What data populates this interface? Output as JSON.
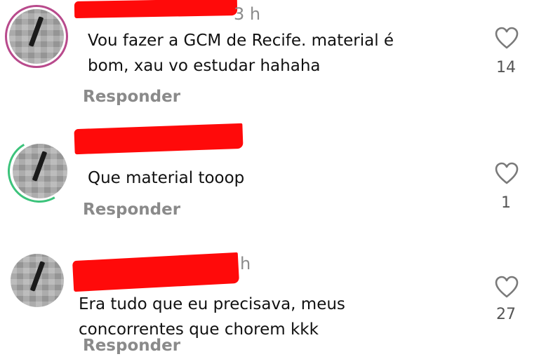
{
  "comments": [
    {
      "time": "3 h",
      "lines": [
        "Vou fazer a GCM de Recife. material é",
        "bom, xau vo estudar hahaha"
      ],
      "reply_label": "Responder",
      "likes": "14",
      "ring_color": "#b84a8c"
    },
    {
      "time": "",
      "lines": [
        "Que material tooop"
      ],
      "reply_label": "Responder",
      "likes": "1",
      "ring_color": "#3cc37b"
    },
    {
      "time": "h",
      "lines": [
        "Era tudo que eu precisava, meus",
        "concorrentes que chorem kkk"
      ],
      "reply_label": "Responder",
      "likes": "27",
      "ring_color": ""
    }
  ],
  "colors": {
    "redaction": "#ff0a0a",
    "text": "#111111",
    "muted": "#8a8a8a",
    "heart": "#7a7a7a"
  },
  "icons": {
    "like": "heart-outline-icon"
  }
}
